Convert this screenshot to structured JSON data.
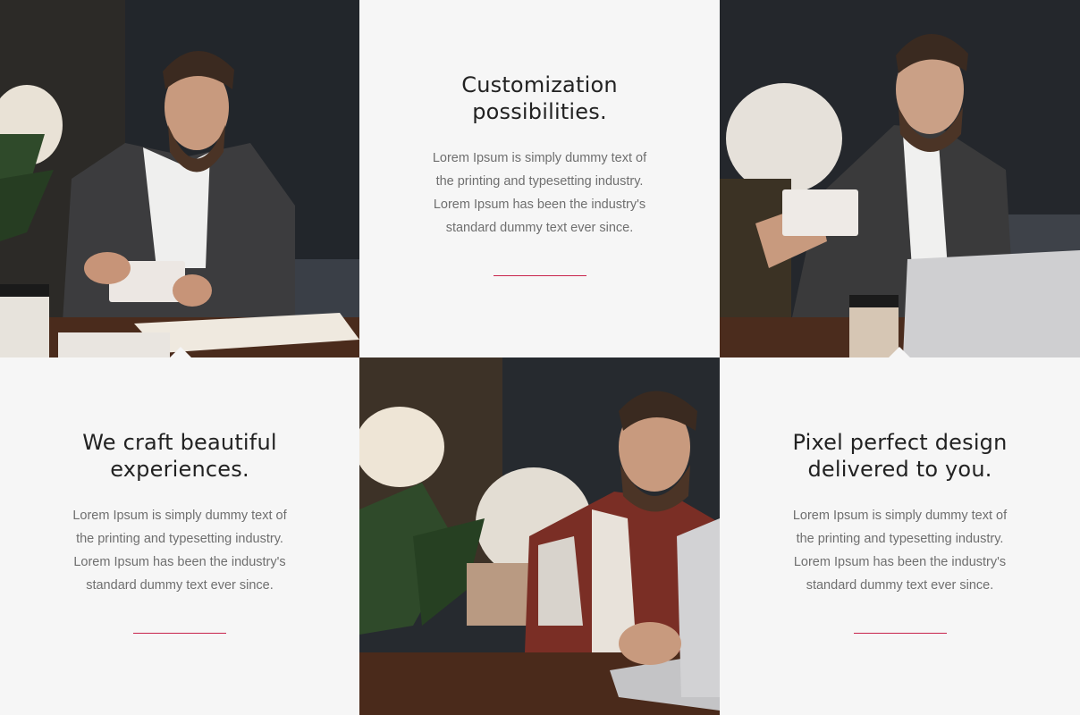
{
  "features": [
    {
      "title": "Customization possibilities.",
      "body": "Lorem Ipsum is simply dummy text of the printing and typesetting industry. Lorem Ipsum has been the industry's standard dummy text ever since."
    },
    {
      "title": "We craft beautiful experiences.",
      "body": "Lorem Ipsum is simply dummy text of the printing and typesetting industry. Lorem Ipsum has been the industry's standard dummy text ever since."
    },
    {
      "title": "Pixel perfect design delivered to you.",
      "body": "Lorem Ipsum is simply dummy text of the printing and typesetting industry. Lorem Ipsum has been the industry's standard dummy text ever since."
    }
  ],
  "colors": {
    "accent": "#c8234b",
    "panel_bg": "#f6f6f6",
    "heading": "#222222",
    "body_text": "#6f6f6f"
  }
}
